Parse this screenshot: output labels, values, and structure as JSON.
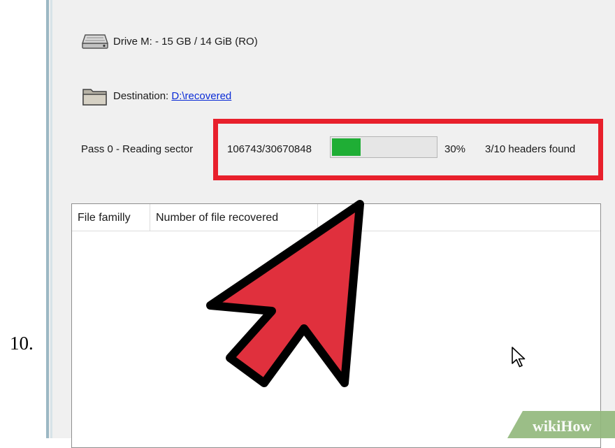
{
  "step": {
    "number": "10."
  },
  "drive": {
    "icon": "hard-drive-icon",
    "label": "Drive M: - 15 GB / 14 GiB (RO)"
  },
  "destination": {
    "icon": "folder-icon",
    "label": "Destination:",
    "path": "D:\\recovered"
  },
  "status": {
    "pass_label": "Pass 0 - Reading sector",
    "sector": "106743/30670848",
    "progress_percent": 30,
    "progress_fill_fraction": 0.28,
    "progress_color": "#1fae35",
    "percent_text": "30%",
    "headers_text": "3/10 headers found",
    "highlight_color": "#e8202c"
  },
  "results_table": {
    "columns": [
      "File familly",
      "Number of file recovered"
    ],
    "rows": []
  },
  "overlay": {
    "arrow_icon": "red-pointer-arrow-icon",
    "cursor_icon": "mouse-cursor-icon"
  },
  "watermark": {
    "text": "wikiHow"
  }
}
